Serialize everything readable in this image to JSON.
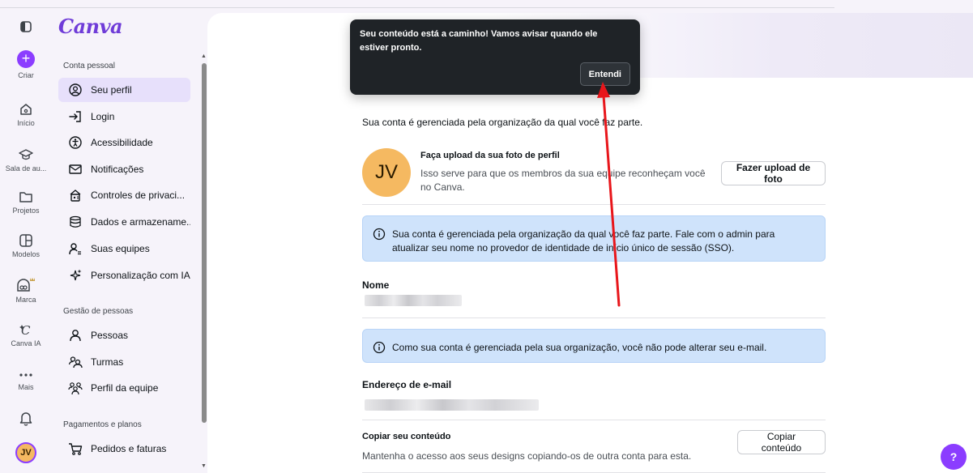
{
  "rail": {
    "create": "Criar",
    "home": "Início",
    "classroom": "Sala de au...",
    "projects": "Projetos",
    "templates": "Modelos",
    "brand": "Marca",
    "canva_ai": "Canva IA",
    "more": "Mais",
    "avatar": "JV"
  },
  "sidebar": {
    "logo": "Canva",
    "personal_title": "Conta pessoal",
    "personal_items": [
      {
        "label": "Seu perfil",
        "icon": "profile-icon"
      },
      {
        "label": "Login",
        "icon": "login-icon"
      },
      {
        "label": "Acessibilidade",
        "icon": "accessibility-icon"
      },
      {
        "label": "Notificações",
        "icon": "mail-icon"
      },
      {
        "label": "Controles de privaci...",
        "icon": "lock-icon"
      },
      {
        "label": "Dados e armazename...",
        "icon": "database-icon"
      },
      {
        "label": "Suas equipes",
        "icon": "team-icon"
      },
      {
        "label": "Personalização com IA",
        "icon": "sparkle-icon"
      }
    ],
    "people_title": "Gestão de pessoas",
    "people_items": [
      {
        "label": "Pessoas",
        "icon": "person-icon"
      },
      {
        "label": "Turmas",
        "icon": "group-icon"
      },
      {
        "label": "Perfil da equipe",
        "icon": "team-profile-icon"
      }
    ],
    "billing_title": "Pagamentos e planos",
    "billing_items": [
      {
        "label": "Pedidos e faturas",
        "icon": "cart-icon"
      }
    ]
  },
  "toast": {
    "message": "Seu conteúdo está a caminho! Vamos avisar quando ele estiver pronto.",
    "button": "Entendi"
  },
  "main": {
    "managed_note": "Sua conta é gerenciada pela organização da qual você faz parte.",
    "photo": {
      "avatar": "JV",
      "title": "Faça upload da sua foto de perfil",
      "description": "Isso serve para que os membros da sua equipe reconheçam você no Canva.",
      "button": "Fazer upload de foto"
    },
    "info_sso": "Sua conta é gerenciada pela organização da qual você faz parte. Fale com o admin para atualizar seu nome no provedor de identidade de início único de sessão (SSO).",
    "name_label": "Nome",
    "info_email": "Como sua conta é gerenciada pela sua organização, você não pode alterar seu e-mail.",
    "email_label": "Endereço de e-mail",
    "copy": {
      "title": "Copiar seu conteúdo",
      "description": "Mantenha o acesso aos seus designs copiando-os de outra conta para esta.",
      "button": "Copiar conteúdo"
    }
  },
  "help_button": "?",
  "colors": {
    "accent": "#8b3dff",
    "info_bg": "#cfe3fb",
    "annotation_arrow": "#e8161b"
  }
}
